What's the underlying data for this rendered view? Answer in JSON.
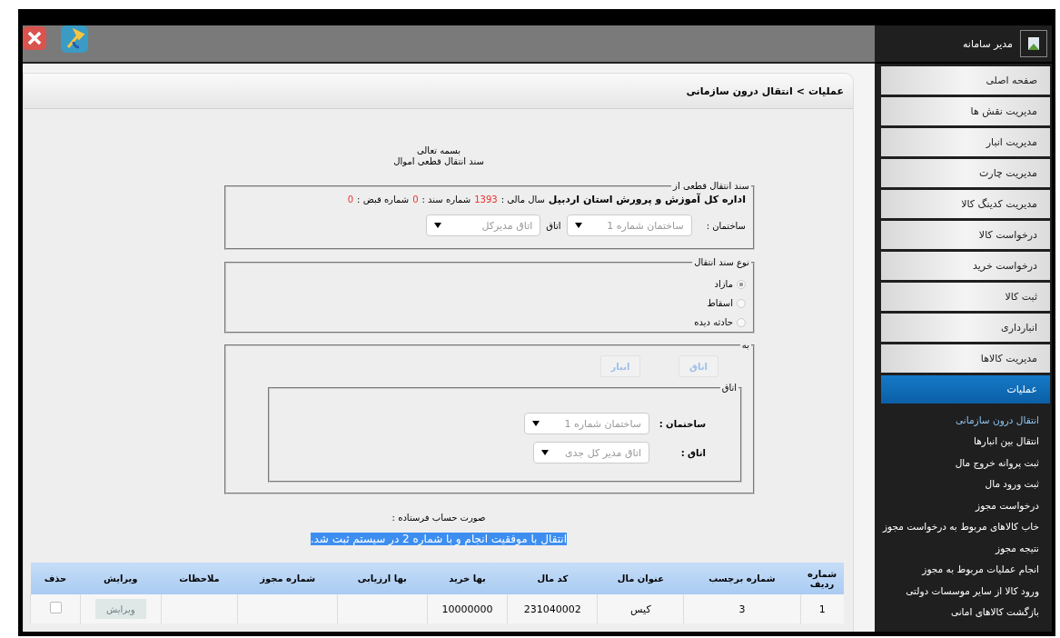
{
  "sidebar": {
    "user": "مدیر سامانه",
    "menu": [
      {
        "label": "صفحه اصلی",
        "selected": false
      },
      {
        "label": "مدیریت نقش ها",
        "selected": false
      },
      {
        "label": "مدیریت انبار",
        "selected": false
      },
      {
        "label": "مدیریت چارت",
        "selected": false
      },
      {
        "label": "مدیریت کدینگ کالا",
        "selected": false
      },
      {
        "label": "درخواست کالا",
        "selected": false
      },
      {
        "label": "درخواست خرید",
        "selected": false
      },
      {
        "label": "ثبت کالا",
        "selected": false
      },
      {
        "label": "انبارداری",
        "selected": false
      },
      {
        "label": "مدیریت کالاها",
        "selected": false
      },
      {
        "label": "عملیات",
        "selected": true
      }
    ],
    "submenu": [
      {
        "label": "انتقال درون سازمانی",
        "selected": true
      },
      {
        "label": "انتقال بین انبارها",
        "selected": false
      },
      {
        "label": "ثبت پروانه خروج مال",
        "selected": false
      },
      {
        "label": "ثبت ورود مال",
        "selected": false
      },
      {
        "label": "درخواست مجوز",
        "selected": false
      },
      {
        "label": "خاب کالاهای مربوط به درخواست مجوز",
        "selected": false
      },
      {
        "label": "نتیجه مجوز",
        "selected": false
      },
      {
        "label": "انجام عملیات مربوط به مجوز",
        "selected": false
      },
      {
        "label": "ورود کالا از سایر موسسات دولتی",
        "selected": false
      },
      {
        "label": "بازگشت کالاهای امانی",
        "selected": false
      }
    ]
  },
  "breadcrumb": {
    "parent": "عملیات",
    "separator": ">",
    "current": "انتقال درون سازمانی"
  },
  "heading": [
    "بسمه تعالی",
    "سند انتقال قطعی اموال"
  ],
  "from_section": {
    "legend": "سند انتقال قطعی از",
    "organization": "اداره کل آموزش و پرورش استان اردبیل",
    "fiscal_year_label": "سال مالی :",
    "fiscal_year": "1393",
    "doc_number_label": "شماره سند :",
    "doc_number": "0",
    "receipt_label": "شماره قبض :",
    "receipt": "0",
    "building_label": "ساختمان :",
    "building": "ساختمان شماره 1",
    "room_label": "اتاق",
    "room": "اتاق مدیرکل"
  },
  "transfer_type": {
    "legend": "نوع سند انتقال",
    "options": [
      {
        "label": "مازاد",
        "selected": true
      },
      {
        "label": "اسقاط",
        "selected": false
      },
      {
        "label": "حادثه دیده",
        "selected": false
      }
    ]
  },
  "to_section": {
    "legend": "به",
    "buttons": [
      "اتاق",
      "انبار"
    ],
    "room_box": {
      "legend": "اتاق",
      "building_label": "ساختمان :",
      "building": "ساختمان شماره 1",
      "room_label": "اتاق :",
      "room": "اتاق مدیر کل جدی"
    }
  },
  "invoice_label": "صورت حساب فرستاده :",
  "message": "انتقال با موفقیت انجام و با شماره 2 در سیستم ثبت شد.",
  "table": {
    "columns": [
      "شماره ردیف",
      "شماره برچسب",
      "عنوان مال",
      "کد مال",
      "بها خرید",
      "بها ارزیابی",
      "شماره مجوز",
      "ملاحظات",
      "ویرایش",
      "حذف"
    ],
    "rows": [
      {
        "cells": [
          "1",
          "3",
          "کیس",
          "231040002",
          "10000000",
          null,
          null,
          null
        ],
        "edit_button": "ویرایش",
        "checked": false
      }
    ]
  }
}
